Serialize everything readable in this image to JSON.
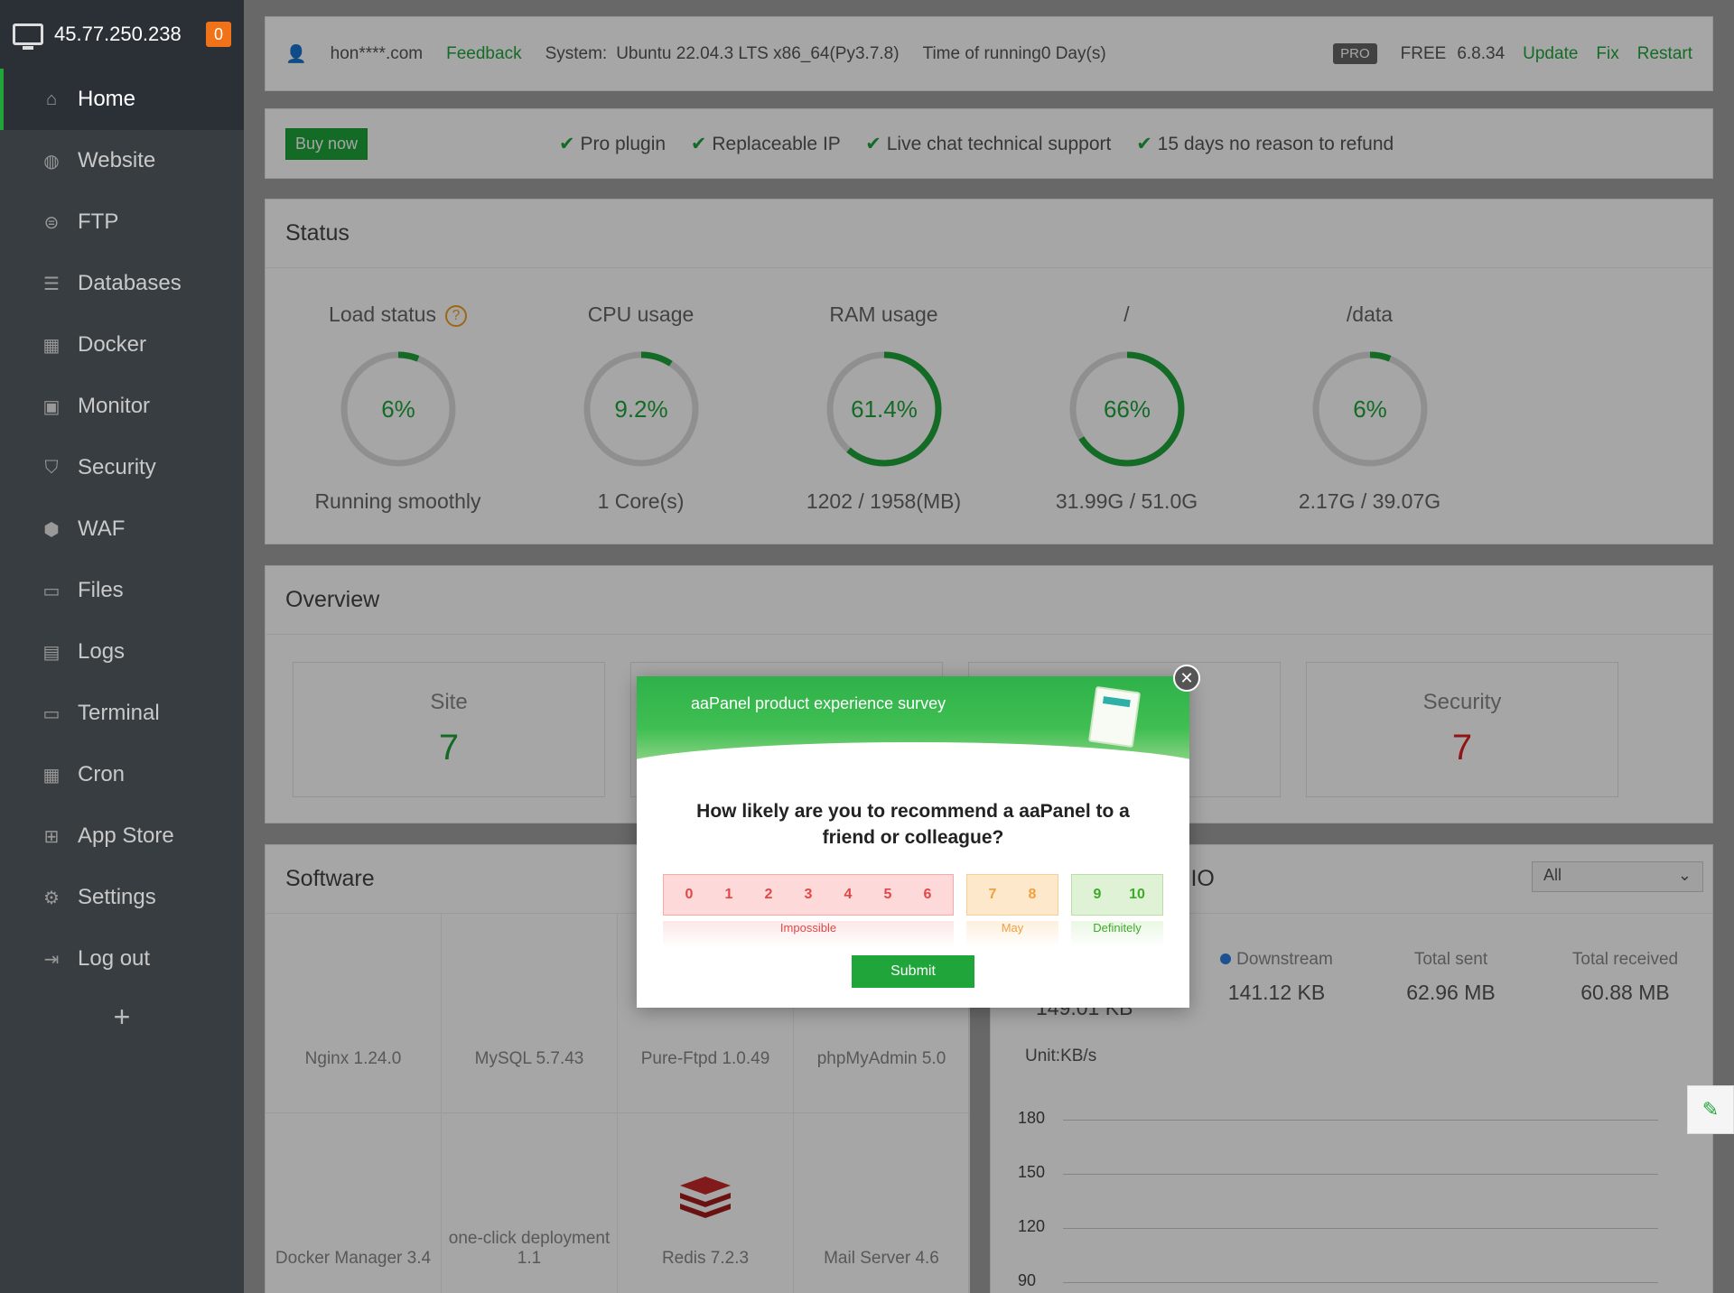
{
  "brand": {
    "ip": "45.77.250.238",
    "badge": "0"
  },
  "nav": [
    {
      "label": "Home",
      "icon": "home-icon"
    },
    {
      "label": "Website",
      "icon": "globe-icon"
    },
    {
      "label": "FTP",
      "icon": "ftp-icon"
    },
    {
      "label": "Databases",
      "icon": "database-icon"
    },
    {
      "label": "Docker",
      "icon": "docker-icon"
    },
    {
      "label": "Monitor",
      "icon": "monitor-icon"
    },
    {
      "label": "Security",
      "icon": "shield-icon"
    },
    {
      "label": "WAF",
      "icon": "waf-icon"
    },
    {
      "label": "Files",
      "icon": "folder-icon"
    },
    {
      "label": "Logs",
      "icon": "logs-icon"
    },
    {
      "label": "Terminal",
      "icon": "terminal-icon"
    },
    {
      "label": "Cron",
      "icon": "calendar-icon"
    },
    {
      "label": "App Store",
      "icon": "apps-icon"
    },
    {
      "label": "Settings",
      "icon": "gear-icon"
    },
    {
      "label": "Log out",
      "icon": "logout-icon"
    }
  ],
  "topbar": {
    "user": "hon****.com",
    "feedback": "Feedback",
    "system_label": "System:",
    "system": "Ubuntu 22.04.3 LTS x86_64(Py3.7.8)",
    "running": "Time of running0 Day(s)",
    "pro": "PRO",
    "free": "FREE",
    "version": "6.8.34",
    "update": "Update",
    "fix": "Fix",
    "restart": "Restart"
  },
  "promo": {
    "buy": "Buy now",
    "features": [
      "Pro plugin",
      "Replaceable IP",
      "Live chat technical support",
      "15 days no reason to refund"
    ]
  },
  "status": {
    "title": "Status",
    "gauges": [
      {
        "title": "Load status",
        "value": "6%",
        "percent": 6,
        "sub": "Running smoothly"
      },
      {
        "title": "CPU usage",
        "value": "9.2%",
        "percent": 9.2,
        "sub": "1 Core(s)"
      },
      {
        "title": "RAM usage",
        "value": "61.4%",
        "percent": 61.4,
        "sub": "1202 / 1958(MB)"
      },
      {
        "title": "/",
        "value": "66%",
        "percent": 66,
        "sub": "31.99G / 51.0G"
      },
      {
        "title": "/data",
        "value": "6%",
        "percent": 6,
        "sub": "2.17G / 39.07G"
      }
    ]
  },
  "overview": {
    "title": "Overview",
    "site_label": "Site",
    "site_value": "7",
    "security_label": "Security",
    "security_value": "7"
  },
  "software": {
    "title": "Software",
    "items": [
      "Nginx 1.24.0",
      "MySQL 5.7.43",
      "Pure-Ftpd 1.0.49",
      "phpMyAdmin 5.0",
      "Docker Manager 3.4",
      "one-click deployment 1.1",
      "Redis 7.2.3",
      "Mail Server 4.6"
    ]
  },
  "traffic": {
    "title": "k IO",
    "select": "All",
    "upstream_partial": "149.01 KB",
    "downstream_label": "Downstream",
    "downstream": "141.12 KB",
    "sent_label": "Total sent",
    "sent": "62.96 MB",
    "received_label": "Total received",
    "received": "60.88 MB",
    "unit": "Unit:KB/s",
    "yticks": [
      "180",
      "150",
      "120",
      "90"
    ]
  },
  "survey": {
    "title": "aaPanel product experience survey",
    "question": "How likely are you to recommend a aaPanel to a friend or colleague?",
    "groups": [
      {
        "label": "Impossible",
        "nums": [
          "0",
          "1",
          "2",
          "3",
          "4",
          "5",
          "6"
        ]
      },
      {
        "label": "May",
        "nums": [
          "7",
          "8"
        ]
      },
      {
        "label": "Definitely",
        "nums": [
          "9",
          "10"
        ]
      }
    ],
    "submit": "Submit"
  }
}
